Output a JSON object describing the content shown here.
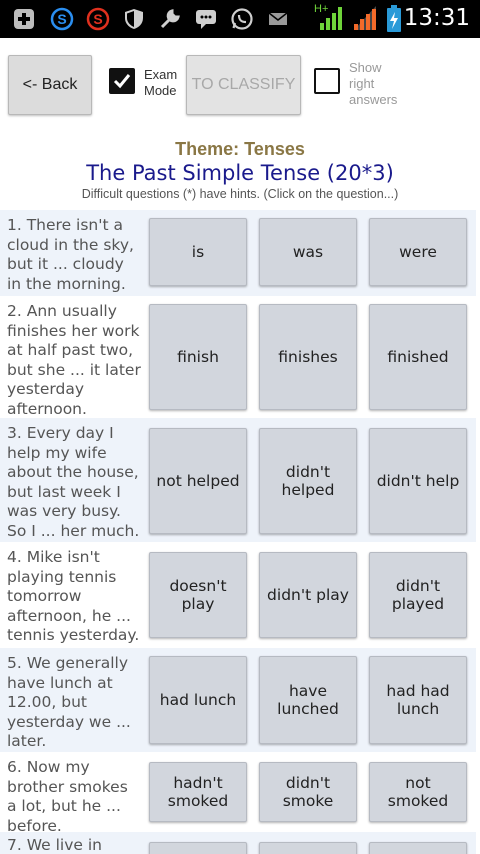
{
  "status_bar": {
    "time": "13:31",
    "network_label": "H+",
    "icons": [
      "plus-icon",
      "skype-icon",
      "skype-red-icon",
      "shield-icon",
      "wrench-icon",
      "chat-icon",
      "whatsapp-icon",
      "mail-icon",
      "signal-icon",
      "signal-weak-icon",
      "battery-icon"
    ]
  },
  "toolbar": {
    "back_label": "<- Back",
    "exam_mode_label": "Exam Mode",
    "exam_mode_checked": true,
    "classify_label": "TO CLASSIFY",
    "show_answers_label": "Show right answers",
    "show_answers_checked": false
  },
  "header": {
    "theme": "Theme: Tenses",
    "title": "The Past Simple Tense (20*3)",
    "hint": "Difficult questions (*) have hints. (Click on the question...)"
  },
  "questions": [
    {
      "text": "1. There isn't a cloud in the sky, but it ... cloudy in the morning.",
      "answers": [
        "is",
        "was",
        "were"
      ]
    },
    {
      "text": "2. Ann usually finishes her work at half past two, but she ... it later yesterday afternoon.",
      "answers": [
        "finish",
        "finishes",
        "finished"
      ]
    },
    {
      "text": "3. Every day I help my wife about the house, but last week I was very busy. So I ... her much.",
      "answers": [
        "not helped",
        "didn't helped",
        "didn't help"
      ]
    },
    {
      "text": "4. Mike isn't playing tennis tomorrow afternoon, he ... tennis yesterday.",
      "answers": [
        "doesn't play",
        "didn't play",
        "didn't played"
      ]
    },
    {
      "text": "5. We generally have lunch at 12.00, but yesterday we ... later.",
      "answers": [
        "had lunch",
        "have lunched",
        "had had lunch"
      ]
    },
    {
      "text": "6. Now my brother smokes a lot, but he ... before.",
      "answers": [
        "hadn't smoked",
        "didn't smoke",
        "not smoked"
      ]
    },
    {
      "text": "7. We live in",
      "answers": [
        "",
        "",
        ""
      ]
    }
  ],
  "colors": {
    "theme": "#8a7745",
    "title": "#1a1a8c",
    "answer_button": "#d2d6dd",
    "row_alt": "#eef3fa"
  }
}
